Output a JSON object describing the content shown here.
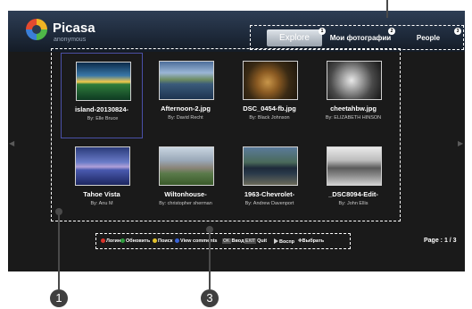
{
  "app": {
    "name": "Picasa",
    "user": "anonymous"
  },
  "tabs": [
    {
      "label": "Explore",
      "badge": "1",
      "active": true
    },
    {
      "label": "Мои фотографии",
      "badge": "2",
      "active": false
    },
    {
      "label": "People",
      "badge": "3",
      "active": false
    }
  ],
  "photos": [
    {
      "name": "island-20130824-",
      "author": "By: Elle Bruce",
      "icon": "island-photo"
    },
    {
      "name": "Afternoon-2.jpg",
      "author": "By: David Recht",
      "icon": "lake-photo"
    },
    {
      "name": "DSC_0454-fb.jpg",
      "author": "By: Black Johnson",
      "icon": "lion-photo"
    },
    {
      "name": "cheetahbw.jpg",
      "author": "By: ELIZABETH HINSON",
      "icon": "cheetah-photo"
    },
    {
      "name": "Tahoe Vista",
      "author": "By: Anu M",
      "icon": "pier-photo"
    },
    {
      "name": "Wiltonhouse-",
      "author": "By: christopher sherman",
      "icon": "house-photo"
    },
    {
      "name": "1963-Chevrolet-",
      "author": "By: Andrew Davenport",
      "icon": "car-photo"
    },
    {
      "name": "_DSC8094-Edit-",
      "author": "By: John Ellis",
      "icon": "forest-photo"
    }
  ],
  "helpbar": {
    "login": "Логин",
    "refresh": "Обновить",
    "search": "Поиск",
    "comments": "View comments",
    "ok_key": "OK",
    "ok": "Ввод",
    "exit_key": "EXIT",
    "exit": "Quit",
    "play": "Воспр",
    "select": "Выбрать"
  },
  "page_info": "Page : 1 / 3",
  "callouts": {
    "one": "1",
    "three": "3"
  },
  "colors": {
    "login_dot": "#d9342b",
    "refresh_dot": "#2f9e3f",
    "search_dot": "#e3c22a",
    "comments_dot": "#3a64d8",
    "selection": "#4a50a8"
  }
}
